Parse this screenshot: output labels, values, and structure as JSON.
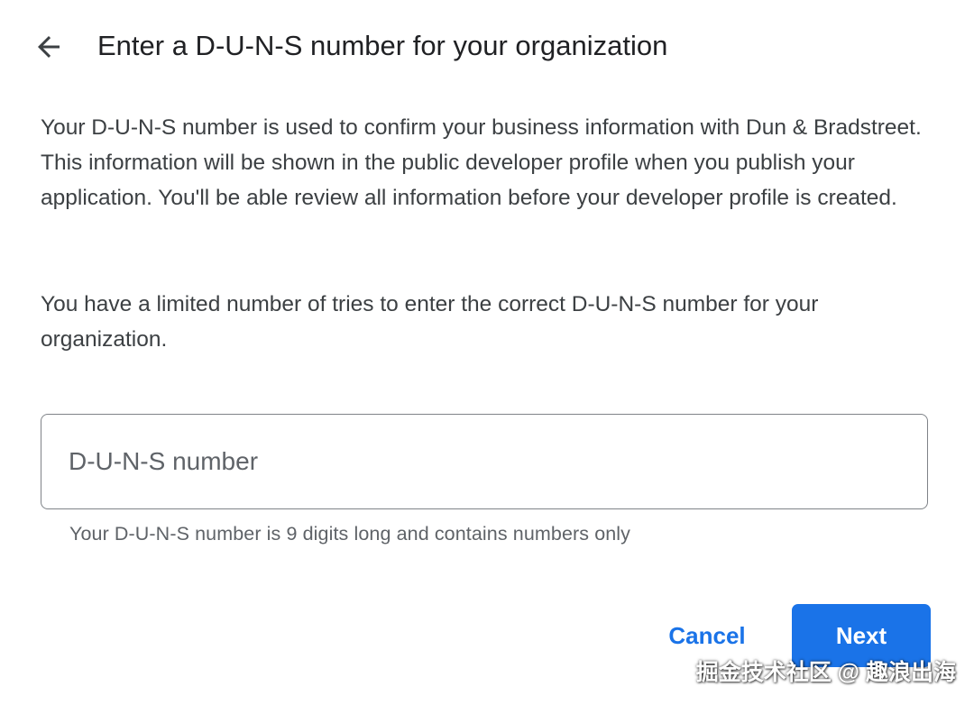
{
  "header": {
    "back_icon": "arrow-back-icon",
    "title": "Enter a D-U-N-S number for your organization"
  },
  "body": {
    "paragraph_1": "Your D-U-N-S number is used to confirm your business information with Dun & Bradstreet. This information will be shown in the public developer profile when you publish your application. You'll be able review all information before your developer profile is created.",
    "paragraph_2": "You have a limited number of tries to enter the correct D-U-N-S number for your organization."
  },
  "duns_input": {
    "value": "",
    "placeholder": "D-U-N-S number",
    "helper_text": "Your D-U-N-S number is 9 digits long and contains numbers only"
  },
  "actions": {
    "cancel_label": "Cancel",
    "next_label": "Next"
  },
  "watermark": "掘金技术社区 @ 趣浪出海",
  "colors": {
    "accent": "#1a73e8",
    "title_text": "#202124",
    "body_text": "#3c4043",
    "helper_text": "#5f6368",
    "input_border": "#7f8388"
  }
}
